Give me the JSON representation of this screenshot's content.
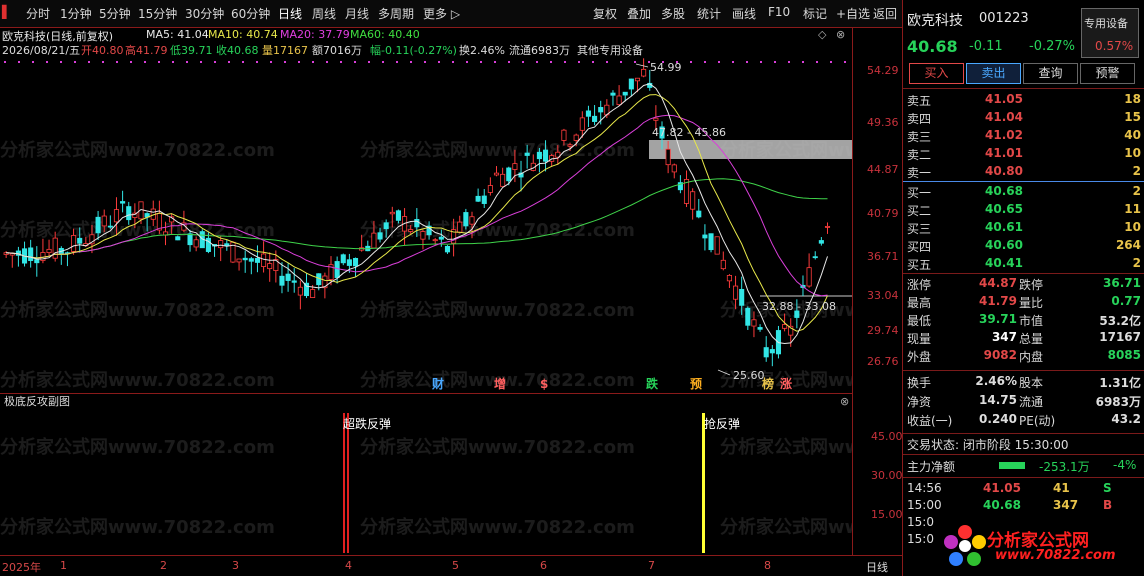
{
  "toolbar": {
    "items": [
      "分时",
      "1分钟",
      "5分钟",
      "15分钟",
      "30分钟",
      "60分钟",
      "日线",
      "周线",
      "月线",
      "多周期",
      "更多 ▷"
    ],
    "right_items": [
      "复权",
      "叠加",
      "多股",
      "统计",
      "画线",
      "F10",
      "标记",
      "+自选",
      "返回"
    ]
  },
  "chart": {
    "title": "欧克科技(日线,前复权)",
    "ma5": "MA5: 41.04",
    "ma10": "MA10: 40.74",
    "ma20": "MA20: 37.79",
    "ma60": "MA60: 40.40",
    "info": {
      "date": "2026/08/21/五",
      "open": "开40.80",
      "high": "高41.79",
      "low": "低39.71",
      "close": "收40.68",
      "vol": "量17167",
      "amt": "额7016万",
      "amp": "幅-0.11(-0.27%)",
      "turn": "换2.46%",
      "float": "流通6983万",
      "other": "其他专用设备"
    },
    "price_labels": [
      "54.29",
      "49.36",
      "44.87",
      "40.79",
      "36.71",
      "33.04",
      "29.74",
      "26.76"
    ],
    "annotations": {
      "high": "54.99",
      "band": "47.82 - 45.86",
      "range2": "32.88 - 33.08",
      "low": "25.60"
    },
    "markers": [
      "财",
      "增",
      "$",
      "跌",
      "预",
      "榜",
      "涨"
    ],
    "marker_colors": [
      "#4aa8ff",
      "#ff6060",
      "#ff6060",
      "#27d35a",
      "#ffb020",
      "#e8c34a",
      "#ff6060"
    ]
  },
  "subchart": {
    "title": "极底反攻副图",
    "labels": [
      "45.00",
      "30.00",
      "15.00"
    ],
    "signal1": "超跌反弹",
    "signal2": "抢反弹",
    "footer": "日线"
  },
  "months": [
    "2025年",
    "1",
    "2",
    "3",
    "4",
    "5",
    "6",
    "7",
    "8"
  ],
  "sidebar": {
    "name": "欧克科技",
    "code": "001223",
    "price": "40.68",
    "change": "-0.11",
    "pct": "-0.27%",
    "special": "专用设备",
    "special_pct": "0.57%",
    "buttons": [
      "买入",
      "卖出",
      "查询",
      "预警"
    ],
    "asks": [
      {
        "lab": "卖五",
        "px": "41.05",
        "vol": "18"
      },
      {
        "lab": "卖四",
        "px": "41.04",
        "vol": "15"
      },
      {
        "lab": "卖三",
        "px": "41.02",
        "vol": "40"
      },
      {
        "lab": "卖二",
        "px": "41.01",
        "vol": "10"
      },
      {
        "lab": "卖一",
        "px": "40.80",
        "vol": "2"
      }
    ],
    "bids": [
      {
        "lab": "买一",
        "px": "40.68",
        "vol": "2"
      },
      {
        "lab": "买二",
        "px": "40.65",
        "vol": "11"
      },
      {
        "lab": "买三",
        "px": "40.61",
        "vol": "10"
      },
      {
        "lab": "买四",
        "px": "40.60",
        "vol": "264"
      },
      {
        "lab": "买五",
        "px": "40.41",
        "vol": "2"
      }
    ],
    "stats": [
      [
        "涨停",
        "44.87",
        "跌停",
        "36.71"
      ],
      [
        "最高",
        "41.79",
        "量比",
        "0.77"
      ],
      [
        "最低",
        "39.71",
        "市值",
        "53.2亿"
      ],
      [
        "现量",
        "347",
        "总量",
        "17167"
      ],
      [
        "外盘",
        "9082",
        "内盘",
        "8085"
      ]
    ],
    "stats2": [
      [
        "换手",
        "2.46%",
        "股本",
        "1.31亿"
      ],
      [
        "净资",
        "14.75",
        "流通",
        "6983万"
      ],
      [
        "收益(一)",
        "0.240",
        "PE(动)",
        "43.2"
      ]
    ],
    "trade_status": "交易状态: 闭市阶段 15:30:00",
    "main_force_label": "主力净额",
    "main_force_value": "-253.1万",
    "main_force_pct": "-4%",
    "ticks": [
      {
        "time": "14:56",
        "px": "41.05",
        "vol": "41",
        "flag": "S"
      },
      {
        "time": "15:00",
        "px": "40.68",
        "vol": "347",
        "flag": "B"
      },
      {
        "time": "15:0",
        "px": "",
        "vol": "",
        "flag": ""
      },
      {
        "time": "15:0",
        "px": "",
        "vol": "",
        "flag": ""
      }
    ],
    "logo_text": "分析家公式网",
    "logo_url": "www.70822.com"
  },
  "watermark": "分析家公式网www.70822.com"
}
